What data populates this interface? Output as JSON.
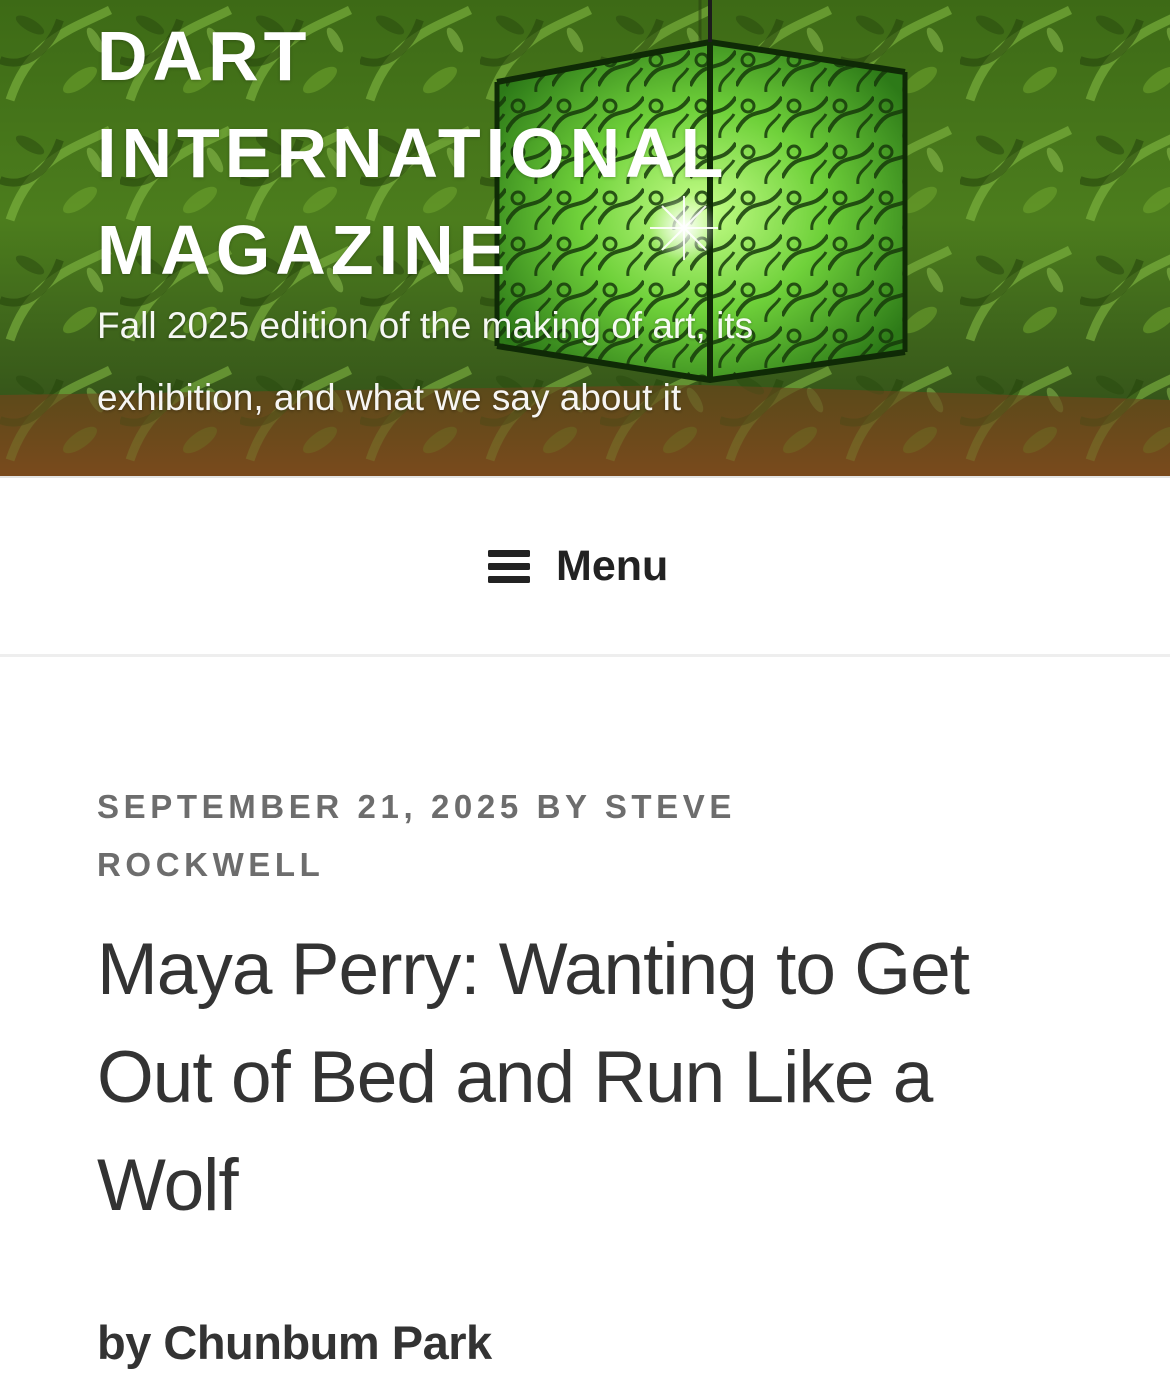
{
  "header": {
    "title_lines": [
      "DART",
      "INTERNATIONAL",
      "MAGAZINE"
    ],
    "description_lines": [
      "Fall 2025 edition of the making of art, its",
      "exhibition, and what we say about it"
    ],
    "background_description_colors": {
      "foliage_dark": "#2f4d10",
      "foliage_light": "#7fb83a",
      "glow": "#9cff6a",
      "floor": "#6b3e1a"
    }
  },
  "nav": {
    "menu_label": "Menu",
    "menu_icon": "hamburger-icon"
  },
  "article": {
    "meta_date": "September 21, 2025",
    "meta_by": "by",
    "meta_author": "Steve Rockwell",
    "title": "Maya Perry: Wanting to Get Out of Bed and Run Like a Wolf",
    "byline": "by Chunbum Park"
  },
  "colors": {
    "meta_text": "#6d6d6d",
    "body_text": "#333333",
    "menu_text": "#222222"
  }
}
